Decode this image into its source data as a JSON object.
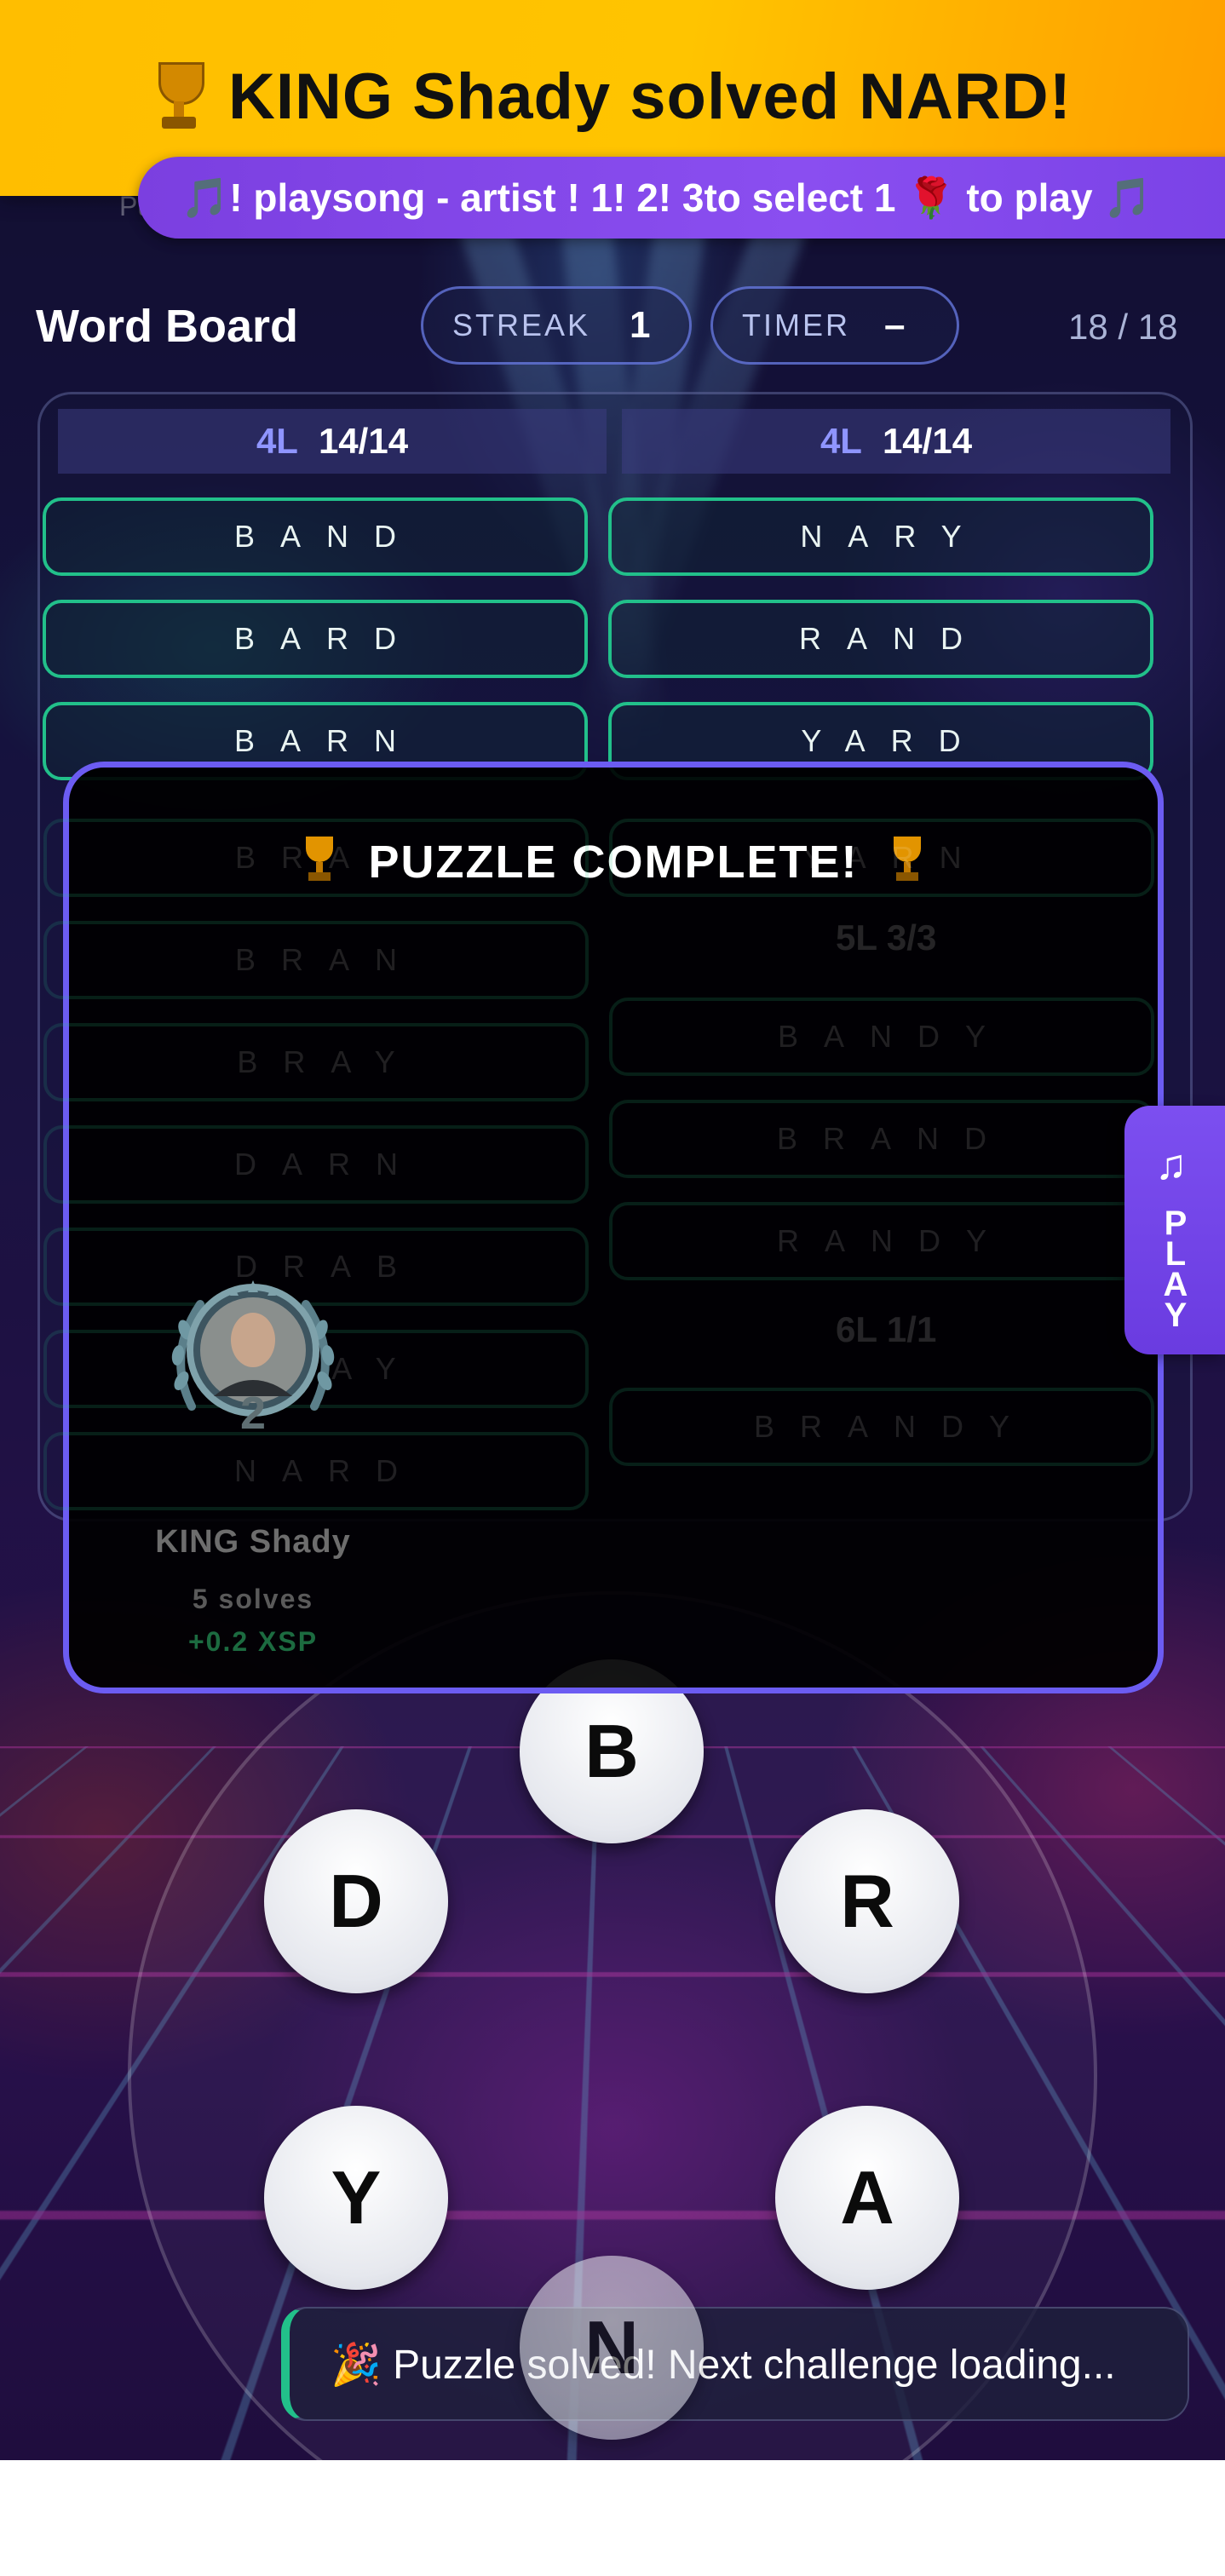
{
  "banner": {
    "text": "KING Shady solved NARD!",
    "icon": "trophy-icon"
  },
  "ticker": {
    "text": "🎵! playsong - artist   ! 1! 2! 3to select   1 🌹 to play   🎵"
  },
  "faint_label": "Puzz",
  "header": {
    "title": "Word Board",
    "streak_label": "STREAK",
    "streak_value": "1",
    "timer_label": "TIMER",
    "timer_value": "–",
    "count": "18 / 18"
  },
  "board": {
    "columns": [
      {
        "len_label": "4L",
        "progress": "14/14"
      },
      {
        "len_label": "4L",
        "progress": "14/14"
      }
    ],
    "left_words": [
      "BAND",
      "BARD",
      "BARN"
    ],
    "right_words": [
      "NARY",
      "RAND",
      "YARD"
    ]
  },
  "modal": {
    "title": "PUZZLE COMPLETE!",
    "ghost_left": [
      "BRAD",
      "BRAN",
      "BRAY",
      "DARN",
      "DRAB",
      "DRAY",
      "NARD"
    ],
    "ghost_right": [
      "YARN",
      "BANDY",
      "BRAND",
      "RANDY",
      "BRANDY"
    ],
    "ghost_heads": [
      "5L 3/3",
      "6L 1/1"
    ],
    "player": {
      "name": "KING Shady",
      "rank": "2",
      "solves": "5 solves",
      "xsp": "+0.2 XSP"
    }
  },
  "play_tab": {
    "icon": "music-note-icon",
    "label": "PLAY"
  },
  "wheel": {
    "letters": [
      "B",
      "R",
      "A",
      "N",
      "Y",
      "D"
    ]
  },
  "toast": {
    "text": "🎉 Puzzle solved! Next challenge loading..."
  },
  "colors": {
    "accent": "#6c5cf2",
    "success": "#22c08a",
    "banner": "#ffc400",
    "ticker": "#8a4ef0"
  }
}
